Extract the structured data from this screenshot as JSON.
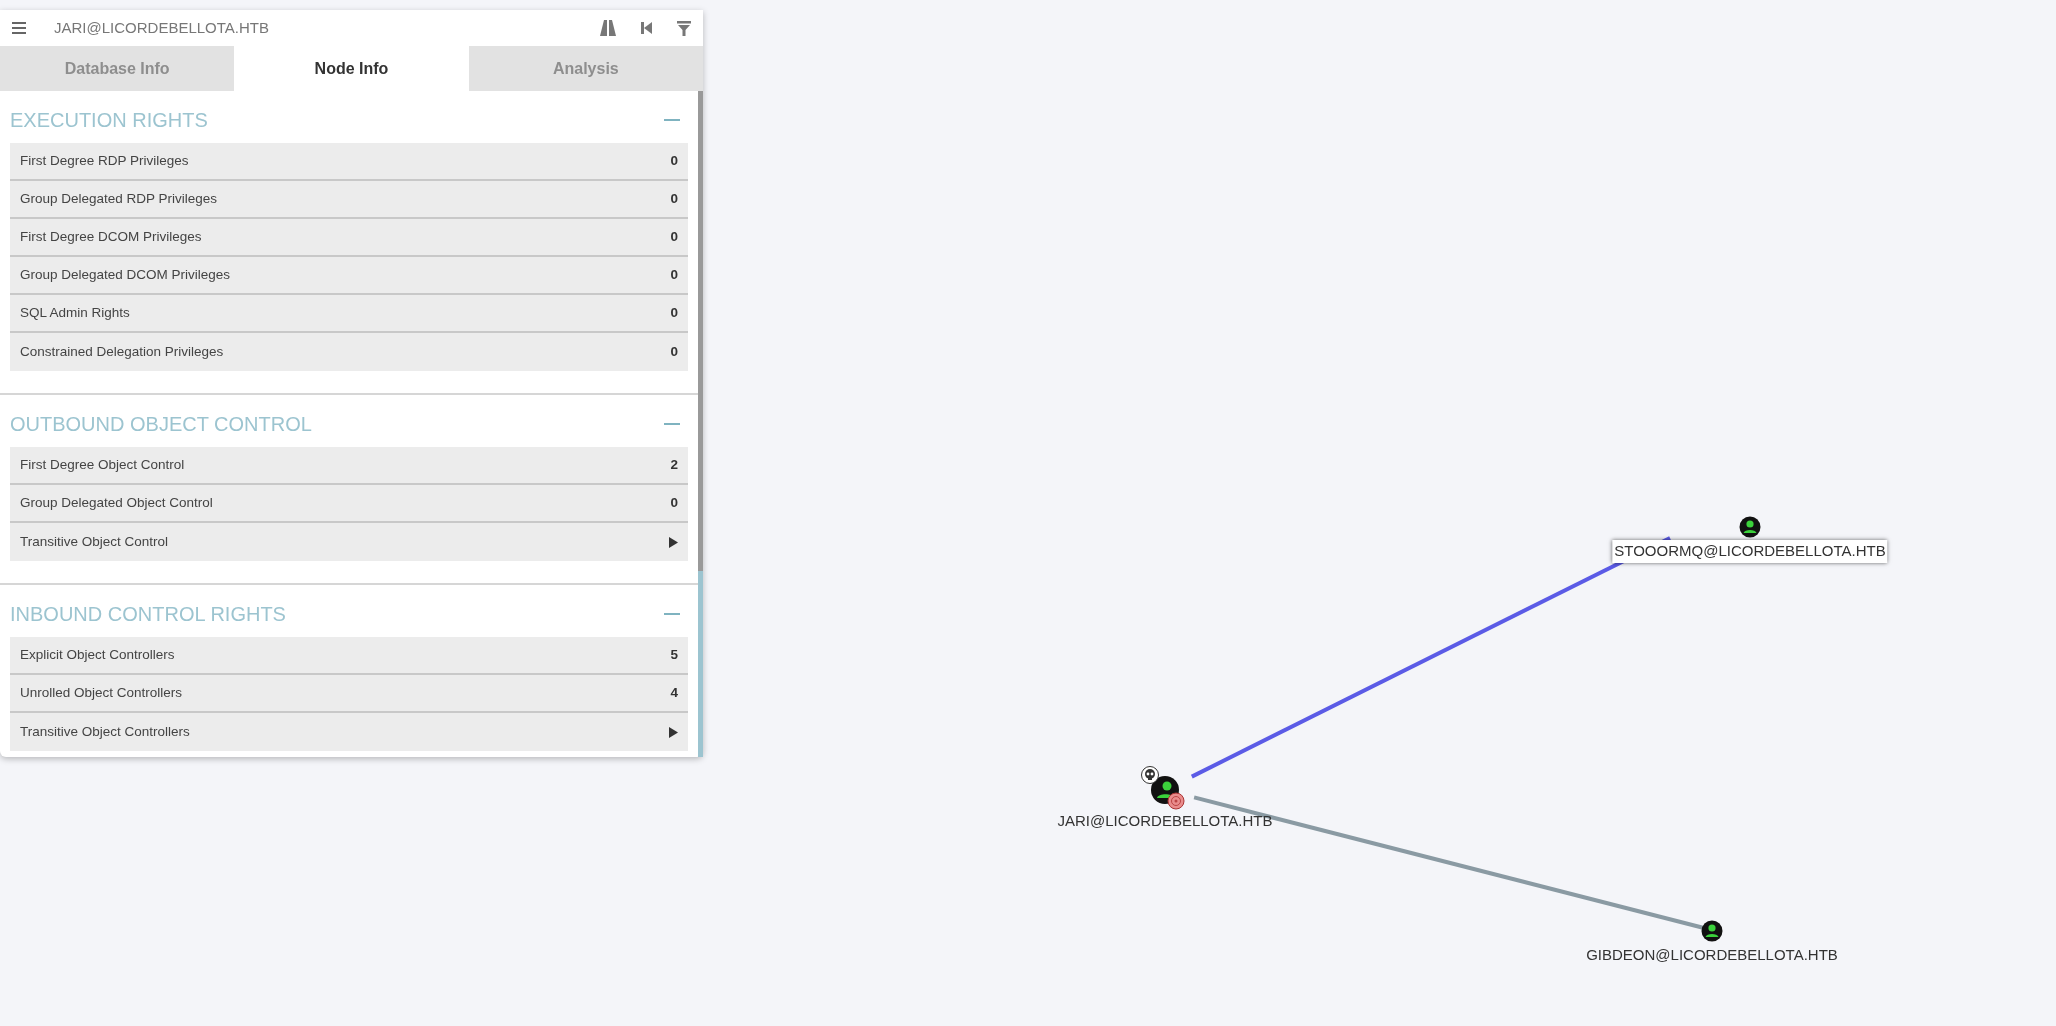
{
  "header": {
    "title": "JARI@LICORDEBELLOTA.HTB"
  },
  "tabs": [
    {
      "label": "Database Info",
      "selected": false
    },
    {
      "label": "Node Info",
      "selected": true
    },
    {
      "label": "Analysis",
      "selected": false
    }
  ],
  "sections": [
    {
      "title": "EXECUTION RIGHTS",
      "expanded": true,
      "rows": [
        {
          "label": "First Degree RDP Privileges",
          "kind": "count",
          "value": "0"
        },
        {
          "label": "Group Delegated RDP Privileges",
          "kind": "count",
          "value": "0"
        },
        {
          "label": "First Degree DCOM Privileges",
          "kind": "count",
          "value": "0"
        },
        {
          "label": "Group Delegated DCOM Privileges",
          "kind": "count",
          "value": "0"
        },
        {
          "label": "SQL Admin Rights",
          "kind": "count",
          "value": "0"
        },
        {
          "label": "Constrained Delegation Privileges",
          "kind": "count",
          "value": "0"
        }
      ]
    },
    {
      "title": "OUTBOUND OBJECT CONTROL",
      "expanded": true,
      "rows": [
        {
          "label": "First Degree Object Control",
          "kind": "count",
          "value": "2"
        },
        {
          "label": "Group Delegated Object Control",
          "kind": "count",
          "value": "0"
        },
        {
          "label": "Transitive Object Control",
          "kind": "expand"
        }
      ]
    },
    {
      "title": "INBOUND CONTROL RIGHTS",
      "expanded": true,
      "rows": [
        {
          "label": "Explicit Object Controllers",
          "kind": "count",
          "value": "5"
        },
        {
          "label": "Unrolled Object Controllers",
          "kind": "count",
          "value": "4"
        },
        {
          "label": "Transitive Object Controllers",
          "kind": "expand"
        }
      ]
    }
  ],
  "graph": {
    "root": {
      "label": "JARI@LICORDEBELLOTA.HTB",
      "owned": true,
      "start_node": true,
      "hovered": false,
      "children": [
        {
          "label": "STOOORMQ@LICORDEBELLOTA.HTB",
          "edge_highlighted": true,
          "hovered": true
        },
        {
          "label": "GIBDEON@LICORDEBELLOTA.HTB",
          "edge_highlighted": false,
          "hovered": false
        }
      ]
    }
  }
}
